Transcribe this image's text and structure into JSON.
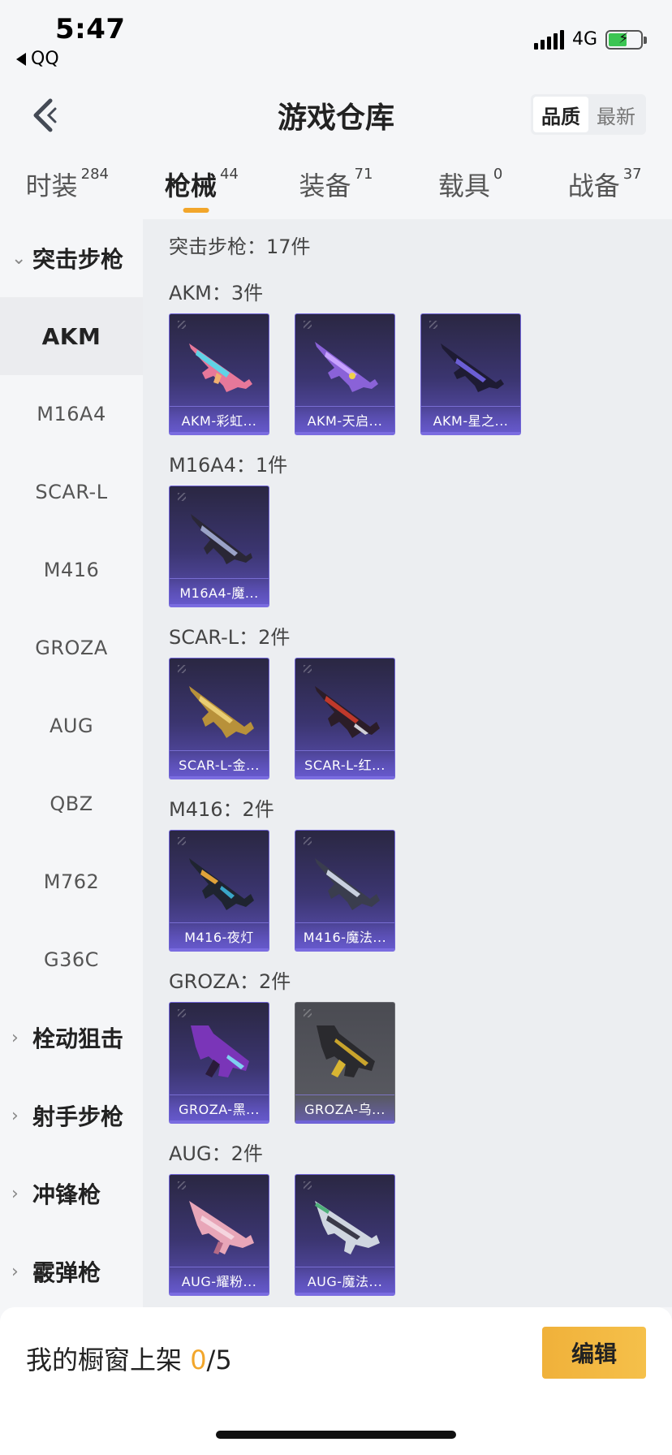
{
  "status_bar": {
    "time": "5:47",
    "back_app": "QQ",
    "network": "4G",
    "battery_fill": 0.58,
    "battery_color": "#3bc552"
  },
  "nav": {
    "title": "游戏仓库",
    "sort_options": [
      "品质",
      "最新"
    ],
    "sort_active": "品质"
  },
  "tabs": [
    {
      "label": "时装",
      "count": "284"
    },
    {
      "label": "枪械",
      "count": "44",
      "active": true
    },
    {
      "label": "装备",
      "count": "71"
    },
    {
      "label": "载具",
      "count": "0"
    },
    {
      "label": "战备",
      "count": "37"
    }
  ],
  "sidebar": {
    "expanded_category": "突击步枪",
    "subcategories": [
      "AKM",
      "M16A4",
      "SCAR-L",
      "M416",
      "GROZA",
      "AUG",
      "QBZ",
      "M762",
      "G36C"
    ],
    "active_sub": "AKM",
    "other_categories": [
      "栓动狙击",
      "射手步枪",
      "冲锋枪",
      "霰弹枪"
    ]
  },
  "main": {
    "heading": "突击步枪：17件",
    "groups": [
      {
        "title": "AKM：3件",
        "items": [
          {
            "name": "AKM-彩虹...",
            "icon": "rainbow-rifle-icon"
          },
          {
            "name": "AKM-天启...",
            "icon": "purple-rifle-icon"
          },
          {
            "name": "AKM-星之...",
            "icon": "dark-rifle-icon"
          }
        ]
      },
      {
        "title": "M16A4：1件",
        "items": [
          {
            "name": "M16A4-魔...",
            "icon": "dark-rifle-icon"
          }
        ]
      },
      {
        "title": "SCAR-L：2件",
        "items": [
          {
            "name": "SCAR-L-金...",
            "icon": "gold-rifle-icon"
          },
          {
            "name": "SCAR-L-红...",
            "icon": "red-rifle-icon"
          }
        ]
      },
      {
        "title": "M416：2件",
        "items": [
          {
            "name": "M416-夜灯",
            "icon": "dark-rifle-icon"
          },
          {
            "name": "M416-魔法...",
            "icon": "silver-rifle-icon"
          }
        ]
      },
      {
        "title": "GROZA：2件",
        "items": [
          {
            "name": "GROZA-黑...",
            "icon": "purple-rifle-icon"
          },
          {
            "name": "GROZA-乌...",
            "icon": "gold-rifle-icon",
            "gray": true
          }
        ]
      },
      {
        "title": "AUG：2件",
        "items": [
          {
            "name": "AUG-耀粉...",
            "icon": "pink-rifle-icon"
          },
          {
            "name": "AUG-魔法...",
            "icon": "silver-rifle-icon"
          }
        ]
      }
    ]
  },
  "bottom": {
    "label": "我的橱窗上架",
    "count": "0",
    "total": "/5",
    "edit_label": "编辑"
  },
  "colors": {
    "accent": "#f2a62b",
    "card_top": "#2a2742",
    "card_bottom": "#5b50b5"
  }
}
